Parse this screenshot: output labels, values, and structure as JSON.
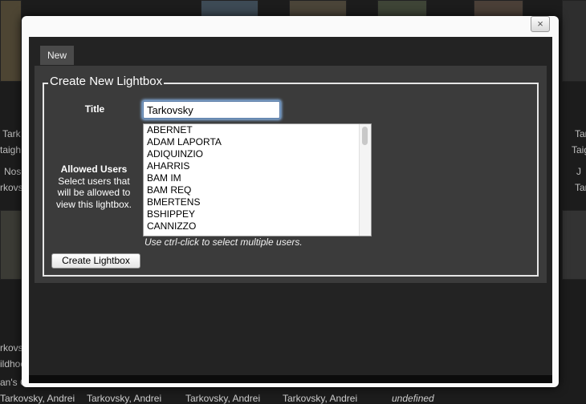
{
  "background": {
    "side_texts_left": [
      "Tark",
      "taigh",
      "Nos",
      "rkovs",
      "rkovs",
      "ildhoo",
      "an's C"
    ],
    "side_texts_right": [
      "Tar",
      "Taig",
      "J",
      "Tar"
    ],
    "bottom_labels": [
      "Tarkovsky, Andrei",
      "Tarkovsky, Andrei",
      "Tarkovsky, Andrei",
      "Tarkovsky, Andrei",
      "undefined"
    ]
  },
  "modal": {
    "close_glyph": "×",
    "tab_label": "New",
    "legend": "Create New Lightbox",
    "title_label": "Title",
    "title_value": "Tarkovsky",
    "allowed_users_heading": "Allowed Users",
    "allowed_users_description": "Select users that will be allowed to view this lightbox.",
    "users": [
      "ABERNET",
      "ADAM LAPORTA",
      "ADIQUINZIO",
      "AHARRIS",
      "BAM IM",
      "BAM REQ",
      "BMERTENS",
      "BSHIPPEY",
      "CANNIZZO"
    ],
    "hint": "Use ctrl-click to select multiple users.",
    "create_button": "Create Lightbox"
  }
}
